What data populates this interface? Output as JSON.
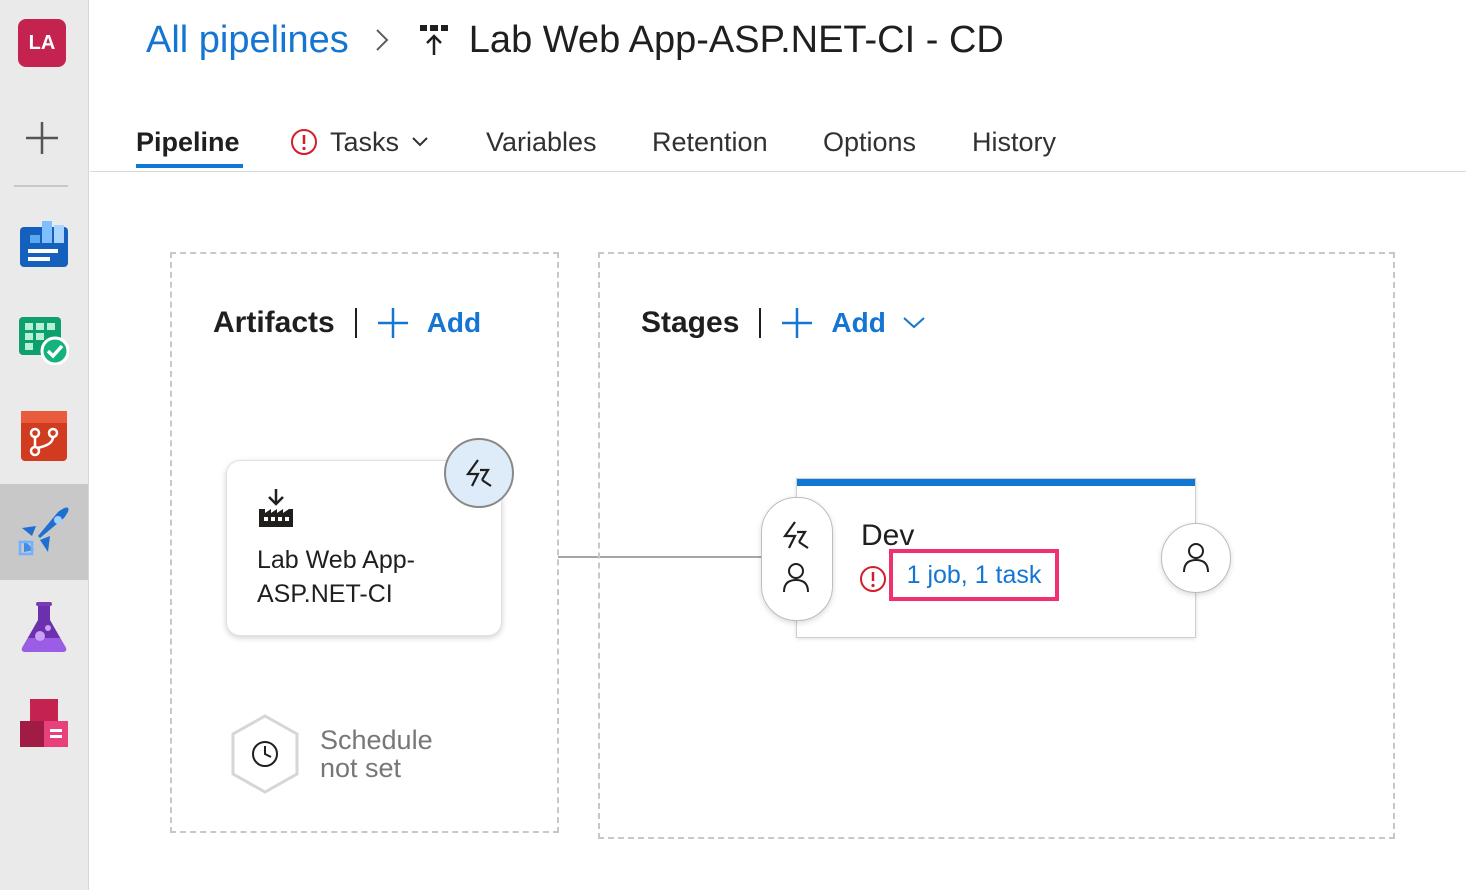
{
  "user": {
    "initials": "LA",
    "avatar_color": "#c4224f"
  },
  "rail": {
    "items": [
      {
        "name": "overview-icon"
      },
      {
        "name": "boards-icon"
      },
      {
        "name": "repos-icon"
      },
      {
        "name": "pipelines-icon",
        "active": true
      },
      {
        "name": "test-plans-icon"
      },
      {
        "name": "artifacts-icon"
      }
    ]
  },
  "breadcrumb": {
    "parent": "All pipelines",
    "title": "Lab Web App-ASP.NET-CI - CD"
  },
  "tabs": [
    {
      "label": "Pipeline",
      "active": true
    },
    {
      "label": "Tasks",
      "warning": true,
      "dropdown": true
    },
    {
      "label": "Variables"
    },
    {
      "label": "Retention"
    },
    {
      "label": "Options"
    },
    {
      "label": "History"
    }
  ],
  "artifacts": {
    "title": "Artifacts",
    "add_label": "Add",
    "artifact_name": "Lab Web App-ASP.NET-CI",
    "schedule_label": "Schedule not set"
  },
  "stages": {
    "title": "Stages",
    "add_label": "Add",
    "stage_name": "Dev",
    "stage_summary": "1 job, 1 task"
  },
  "colors": {
    "accent": "#0f78d4",
    "link": "#1476d2",
    "error": "#d11f2a",
    "highlight": "#f1306e"
  }
}
